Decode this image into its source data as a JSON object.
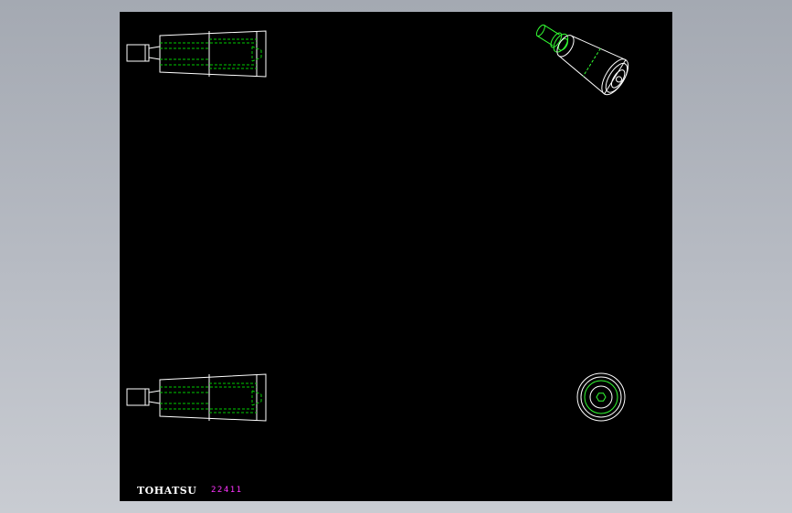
{
  "title_block": {
    "brand": "TOHATSU",
    "part_number": "22411"
  },
  "colors": {
    "background": "#000000",
    "outline": "#ffffff",
    "hidden_line": "#00cc00",
    "green_outline": "#33ff33",
    "part_number_text": "#ff33ff"
  },
  "views": [
    "top-side-view",
    "iso-view",
    "bottom-side-view",
    "end-view"
  ]
}
